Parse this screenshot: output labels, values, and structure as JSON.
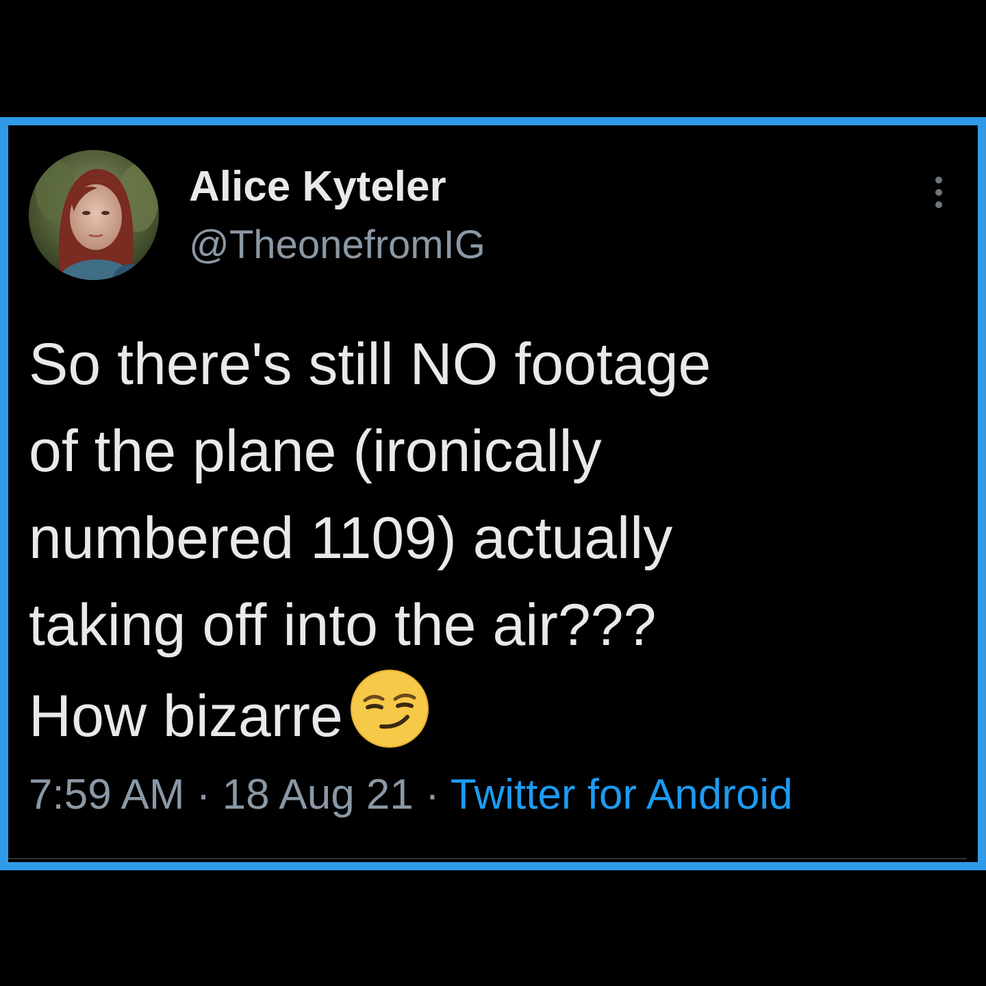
{
  "tweet": {
    "author_name": "Alice Kyteler",
    "author_handle": "@TheonefromIG",
    "body_lines": [
      "So there's still NO footage",
      "of the plane (ironically",
      "numbered 1109) actually",
      "taking off into the air???",
      "How bizarre"
    ],
    "emoji": "smirking-face",
    "time": "7:59 AM",
    "separator": "·",
    "date": "18 Aug 21",
    "source": "Twitter for Android"
  },
  "icons": {
    "more": "vertical-ellipsis-icon",
    "avatar": "profile-photo"
  },
  "colors": {
    "frame_border": "#2f9be8",
    "background": "#000000",
    "text_primary": "#e7e9ea",
    "text_secondary": "#8b98a5",
    "link": "#1d9bf0"
  }
}
